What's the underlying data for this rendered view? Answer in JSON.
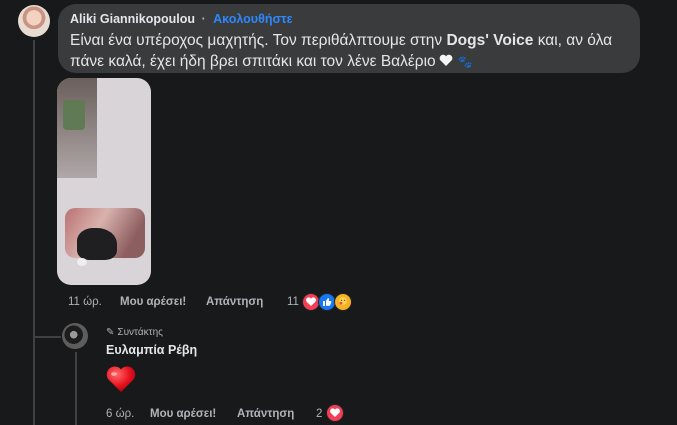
{
  "comment": {
    "author": "Aliki Giannikopoulou",
    "follow_separator": "·",
    "follow_label": "Ακολουθήστε",
    "text_part1": "Είναι ένα υπέροχος μαχητής. Τον περιθάλπτουμε στην ",
    "text_bold": "Dogs' Voice",
    "text_part2": " και, αν όλα πάνε καλά, έχει ήδη βρει σπιτάκι και τον λένε Βαλέριο",
    "time": "11 ώρ.",
    "like_label": "Μου αρέσει!",
    "reply_label": "Απάντηση",
    "reaction_count": "11",
    "reactions": [
      "love-icon",
      "like-icon",
      "care-icon"
    ]
  },
  "reply": {
    "badge_label": "Συντάκτης",
    "author": "Ευλαμπία Ρέβη",
    "content_icon": "red-heart-emoji",
    "time": "6 ώρ.",
    "like_label": "Μου αρέσει!",
    "reply_label": "Απάντηση",
    "reaction_count": "2",
    "reactions": [
      "love-icon"
    ]
  },
  "colors": {
    "background": "#18191a",
    "bubble": "#3a3b3c",
    "link": "#2d88ff",
    "love": "#f33e58",
    "like": "#1877f2",
    "care": "#f7b125"
  }
}
